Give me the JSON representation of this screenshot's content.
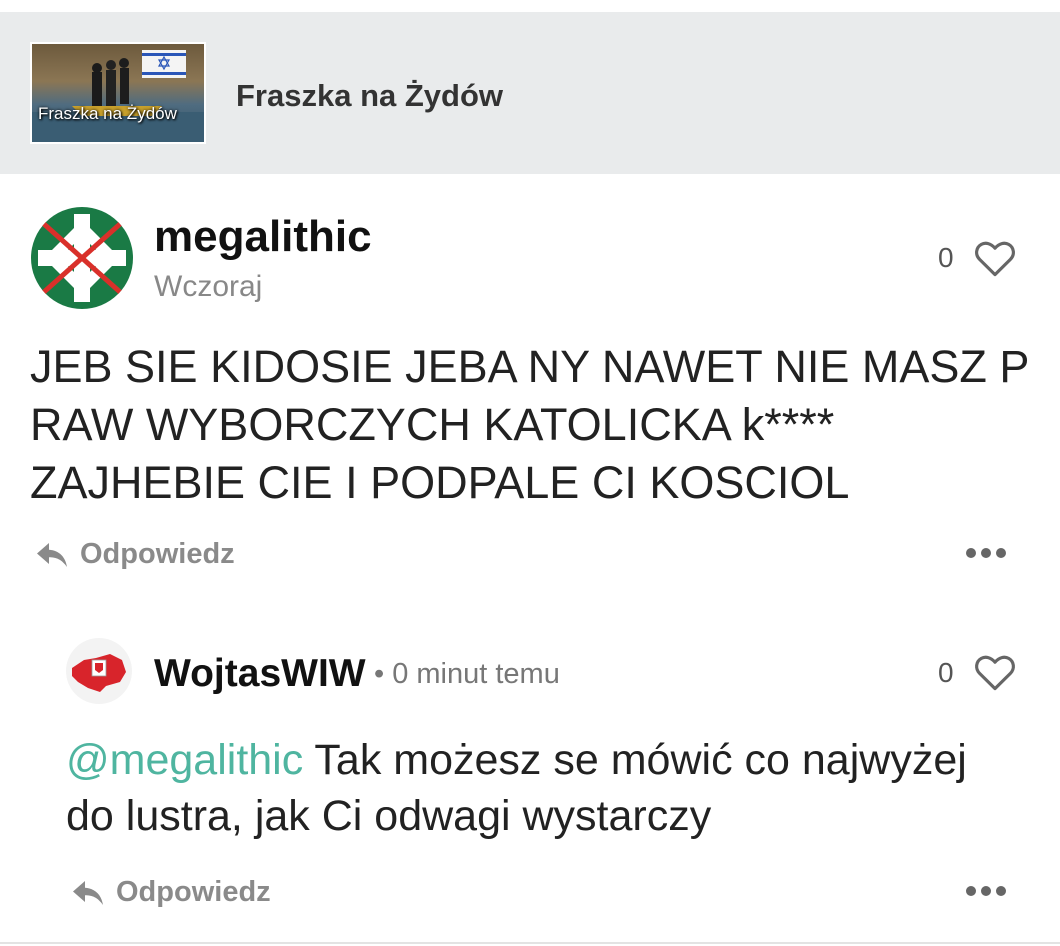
{
  "header": {
    "title": "Fraszka na Żydów",
    "thumbnail_caption": "Fraszka na Żydów"
  },
  "comments": [
    {
      "username": "megalithic",
      "time": "Wczoraj",
      "likes": "0",
      "text": "JEB SIE KIDOSIE JEBA NY NAWET NIE MASZ P RAW WYBORCZYCH KATOLICKA k**** ZAJHEBIE CIE I PODPALE CI KOSCIOL",
      "reply_label": "Odpowiedz"
    },
    {
      "username": "WojtasWIW",
      "separator": "•",
      "time": "0 minut temu",
      "likes": "0",
      "mention": "@megalithic",
      "text": " Tak możesz se mówić co najwyżej do lustra, jak Ci odwagi wystarczy",
      "reply_label": "Odpowiedz"
    }
  ],
  "icons": {
    "like": "heart-outline-icon",
    "reply": "reply-arrow-icon",
    "more": "more-dots-icon"
  },
  "colors": {
    "header_bg": "#e9ebec",
    "mention": "#4fb5a0",
    "avatar_green": "#1a7a45",
    "crossout_red": "#d9302a"
  }
}
